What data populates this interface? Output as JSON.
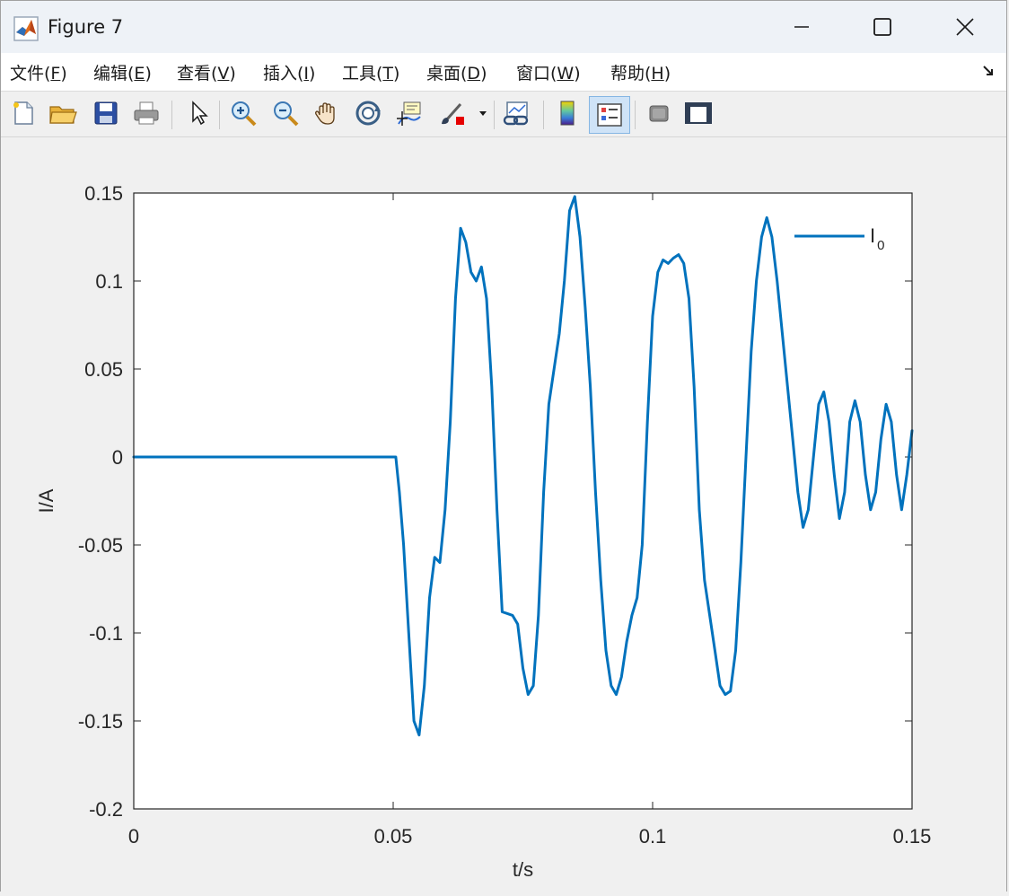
{
  "window": {
    "title": "Figure 7",
    "minimize_label": "—",
    "maximize_label": "☐",
    "close_label": "✕"
  },
  "menu": [
    {
      "label": "文件(",
      "key": "F",
      "suffix": ")"
    },
    {
      "label": "编辑(",
      "key": "E",
      "suffix": ")"
    },
    {
      "label": "查看(",
      "key": "V",
      "suffix": ")"
    },
    {
      "label": "插入(",
      "key": "I",
      "suffix": ")"
    },
    {
      "label": "工具(",
      "key": "T",
      "suffix": ")"
    },
    {
      "label": "桌面(",
      "key": "D",
      "suffix": ")"
    },
    {
      "label": "窗口(",
      "key": "W",
      "suffix": ")"
    },
    {
      "label": "帮助(",
      "key": "H",
      "suffix": ")"
    }
  ],
  "toolbar": {
    "icons": [
      "new-figure-icon",
      "open-file-icon",
      "save-icon",
      "print-icon",
      "pointer-icon",
      "zoom-in-icon",
      "zoom-out-icon",
      "pan-icon",
      "rotate-3d-icon",
      "data-cursor-icon",
      "brush-icon",
      "link-plot-icon",
      "colorbar-icon",
      "legend-icon",
      "hide-plot-tools-icon",
      "show-plot-tools-icon"
    ]
  },
  "colors": {
    "line": "#0072bd",
    "axes_bg": "#ffffff",
    "figure_bg": "#f0f0f0"
  },
  "chart_data": {
    "type": "line",
    "xlabel": "t/s",
    "ylabel": "I/A",
    "xlim": [
      0,
      0.15
    ],
    "ylim": [
      -0.2,
      0.15
    ],
    "xticks": [
      0,
      0.05,
      0.1,
      0.15
    ],
    "xtick_labels": [
      "0",
      "0.05",
      "0.1",
      "0.15"
    ],
    "yticks": [
      0.15,
      0.1,
      0.05,
      0,
      -0.05,
      -0.1,
      -0.15,
      -0.2
    ],
    "ytick_labels": [
      "0.15",
      "0.1",
      "0.05",
      "0",
      "-0.05",
      "-0.1",
      "-0.15",
      "-0.2"
    ],
    "grid": false,
    "legend_position": "top-right",
    "series": [
      {
        "name": "I",
        "name_subscript": "0",
        "x": [
          0,
          0.0505,
          0.0512,
          0.052,
          0.053,
          0.054,
          0.055,
          0.056,
          0.057,
          0.058,
          0.059,
          0.06,
          0.061,
          0.062,
          0.063,
          0.064,
          0.065,
          0.066,
          0.067,
          0.068,
          0.069,
          0.07,
          0.071,
          0.072,
          0.073,
          0.074,
          0.075,
          0.076,
          0.077,
          0.078,
          0.079,
          0.08,
          0.081,
          0.082,
          0.083,
          0.084,
          0.085,
          0.086,
          0.087,
          0.088,
          0.089,
          0.09,
          0.091,
          0.092,
          0.093,
          0.094,
          0.095,
          0.096,
          0.097,
          0.098,
          0.099,
          0.1,
          0.101,
          0.102,
          0.103,
          0.104,
          0.105,
          0.106,
          0.107,
          0.108,
          0.109,
          0.11,
          0.111,
          0.112,
          0.113,
          0.114,
          0.115,
          0.116,
          0.117,
          0.118,
          0.119,
          0.12,
          0.121,
          0.122,
          0.123,
          0.124,
          0.125,
          0.126,
          0.127,
          0.128,
          0.129,
          0.13,
          0.131,
          0.132,
          0.133,
          0.134,
          0.135,
          0.136,
          0.137,
          0.138,
          0.139,
          0.14,
          0.141,
          0.142,
          0.143,
          0.144,
          0.145,
          0.146,
          0.147,
          0.148,
          0.149,
          0.15
        ],
        "y": [
          0,
          0,
          -0.02,
          -0.05,
          -0.1,
          -0.15,
          -0.158,
          -0.13,
          -0.08,
          -0.057,
          -0.06,
          -0.03,
          0.02,
          0.09,
          0.13,
          0.122,
          0.105,
          0.1,
          0.108,
          0.09,
          0.04,
          -0.03,
          -0.088,
          -0.089,
          -0.09,
          -0.095,
          -0.12,
          -0.135,
          -0.13,
          -0.09,
          -0.02,
          0.03,
          0.05,
          0.07,
          0.1,
          0.14,
          0.148,
          0.125,
          0.085,
          0.04,
          -0.02,
          -0.07,
          -0.11,
          -0.13,
          -0.135,
          -0.125,
          -0.105,
          -0.09,
          -0.08,
          -0.05,
          0.02,
          0.08,
          0.105,
          0.112,
          0.11,
          0.113,
          0.115,
          0.11,
          0.09,
          0.04,
          -0.03,
          -0.07,
          -0.09,
          -0.11,
          -0.13,
          -0.135,
          -0.133,
          -0.11,
          -0.06,
          0.0,
          0.06,
          0.1,
          0.125,
          0.136,
          0.125,
          0.1,
          0.07,
          0.04,
          0.01,
          -0.02,
          -0.04,
          -0.03,
          0.0,
          0.03,
          0.037,
          0.02,
          -0.01,
          -0.035,
          -0.02,
          0.02,
          0.032,
          0.02,
          -0.01,
          -0.03,
          -0.02,
          0.01,
          0.03,
          0.02,
          -0.01,
          -0.03,
          -0.01,
          0.015
        ]
      }
    ]
  }
}
